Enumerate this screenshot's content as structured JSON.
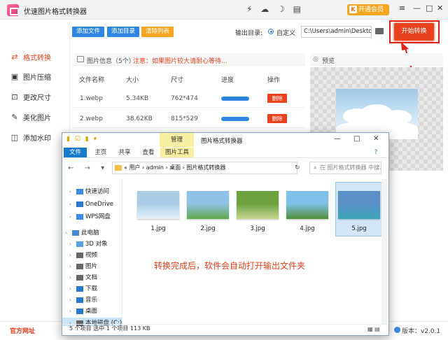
{
  "app": {
    "title": "优速图片格式转换器",
    "vip_label": "开通会员",
    "mid_icons": "⚡ ☁ ☽ ▤"
  },
  "window_controls": {
    "menu": "≡",
    "minimize": "—",
    "maximize": "□",
    "close": "✕"
  },
  "sidebar": {
    "items": [
      {
        "label": "格式转换",
        "icon": "swap-icon",
        "active": true
      },
      {
        "label": "图片压缩",
        "icon": "compress-icon",
        "active": false
      },
      {
        "label": "更改尺寸",
        "icon": "resize-icon",
        "active": false
      },
      {
        "label": "美化图片",
        "icon": "beautify-icon",
        "active": false
      },
      {
        "label": "添加水印",
        "icon": "watermark-icon",
        "active": false
      }
    ]
  },
  "toolbar": {
    "add_file": "添加文件",
    "add_folder": "添加目录",
    "clear_list": "清除列表",
    "output_label": "输出目录:",
    "custom_label": "自定义",
    "output_path": "C:\\Users\\admin\\Deskto",
    "start_button": "开始转换"
  },
  "file_panel": {
    "title": "图片信息（5个）",
    "note": "注意：如果图片较大请耐心等待...",
    "columns": [
      "文件名称",
      "大小",
      "尺寸",
      "进度",
      "操作"
    ],
    "rows": [
      {
        "name": "1.webp",
        "size": "5.34KB",
        "dims": "762*474",
        "progress": 1.0,
        "action": "删除"
      },
      {
        "name": "2.webp",
        "size": "38.62KB",
        "dims": "815*529",
        "progress": 1.0,
        "action": "删除"
      }
    ]
  },
  "preview": {
    "label": "预览"
  },
  "footer": {
    "site": "官方网址",
    "version": "版本：v2.0.1"
  },
  "explorer": {
    "manage_tab": "管理",
    "title": "图片格式转换器",
    "quick_access_icons": "▮ ☑ ▮ ▾",
    "ribbon_tabs": [
      "文件",
      "主页",
      "共享",
      "查看",
      "图片工具"
    ],
    "nav_arrows": "← → ▾ ↑",
    "address": "« 用户 › admin › 桌面 › 图片格式转换器",
    "refresh": "↻",
    "search_placeholder": "在 图片格式转换器 中搜...",
    "nav_tree": [
      {
        "label": "快速访问",
        "indent": 1,
        "icon": "star-icon",
        "color": "#3b8be0"
      },
      {
        "label": "OneDrive",
        "indent": 1,
        "icon": "cloud-icon",
        "color": "#2b78d0"
      },
      {
        "label": "WPS网盘",
        "indent": 1,
        "icon": "cloud-icon",
        "color": "#3a8ee6"
      },
      {
        "label": "此电脑",
        "indent": 0,
        "icon": "computer-icon",
        "color": "#4a8bd6"
      },
      {
        "label": "3D 对象",
        "indent": 1,
        "icon": "cube-icon",
        "color": "#5aa0e0"
      },
      {
        "label": "视频",
        "indent": 1,
        "icon": "video-icon",
        "color": "#666666"
      },
      {
        "label": "图片",
        "indent": 1,
        "icon": "picture-icon",
        "color": "#666666"
      },
      {
        "label": "文档",
        "indent": 1,
        "icon": "document-icon",
        "color": "#666666"
      },
      {
        "label": "下载",
        "indent": 1,
        "icon": "download-icon",
        "color": "#2b78d0"
      },
      {
        "label": "音乐",
        "indent": 1,
        "icon": "music-icon",
        "color": "#2b78d0"
      },
      {
        "label": "桌面",
        "indent": 1,
        "icon": "desktop-icon",
        "color": "#2b78d0"
      },
      {
        "label": "本地磁盘 (C:)",
        "indent": 1,
        "icon": "disk-icon",
        "color": "#666666",
        "selected": true
      }
    ],
    "files": [
      {
        "name": "1.jpg",
        "colors": [
          "#a9cde6",
          "#e8f2f8"
        ]
      },
      {
        "name": "2.jpg",
        "colors": [
          "#8fc2e8",
          "#5fa84a"
        ]
      },
      {
        "name": "3.jpg",
        "colors": [
          "#6fa040",
          "#c8d890"
        ]
      },
      {
        "name": "4.jpg",
        "colors": [
          "#7ec0e8",
          "#4f8f38"
        ]
      },
      {
        "name": "5.jpg",
        "colors": [
          "#5a8fc8",
          "#3aa6b8"
        ],
        "selected": true
      }
    ],
    "message": "转换完成后，软件会自动打开输出文件夹",
    "status": "5 个项目    选中 1 个项目  113 KB",
    "view_icons": "▦ ▤"
  }
}
